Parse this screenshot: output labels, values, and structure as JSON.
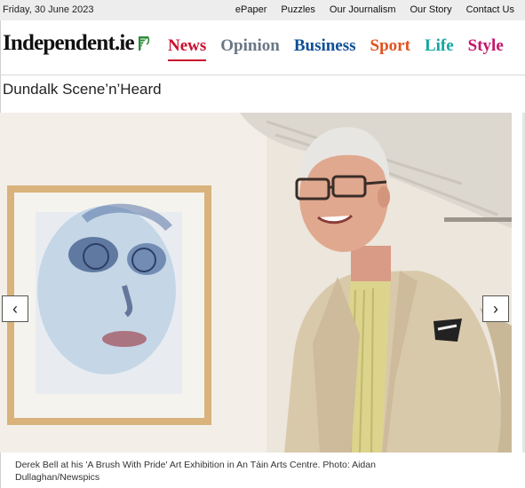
{
  "topbar": {
    "date": "Friday, 30 June 2023",
    "links": [
      "ePaper",
      "Puzzles",
      "Our Journalism",
      "Our Story",
      "Contact Us"
    ]
  },
  "masthead": {
    "logo_text": "Independent.ie",
    "logo_icon": "harp-icon",
    "nav": [
      {
        "label": "News",
        "color": "#c8102e",
        "active": true
      },
      {
        "label": "Opinion",
        "color": "#6b7785",
        "active": false
      },
      {
        "label": "Business",
        "color": "#0d4f96",
        "active": false
      },
      {
        "label": "Sport",
        "color": "#e0531f",
        "active": false
      },
      {
        "label": "Life",
        "color": "#13a6a0",
        "active": false
      },
      {
        "label": "Style",
        "color": "#c4166e",
        "active": false
      }
    ]
  },
  "section": {
    "title": "Dundalk Scene’n’Heard"
  },
  "gallery": {
    "prev_icon": "chevron-left-icon",
    "next_icon": "chevron-right-icon",
    "prev_glyph": "‹",
    "next_glyph": "›",
    "caption": "Derek Bell at his 'A Brush With Pride' Art Exhibition in An Táin Arts Centre. Photo: Aidan Dullaghan/Newspics"
  },
  "colors": {
    "harp": "#2e8b3a",
    "topbar_bg": "#ededed"
  }
}
